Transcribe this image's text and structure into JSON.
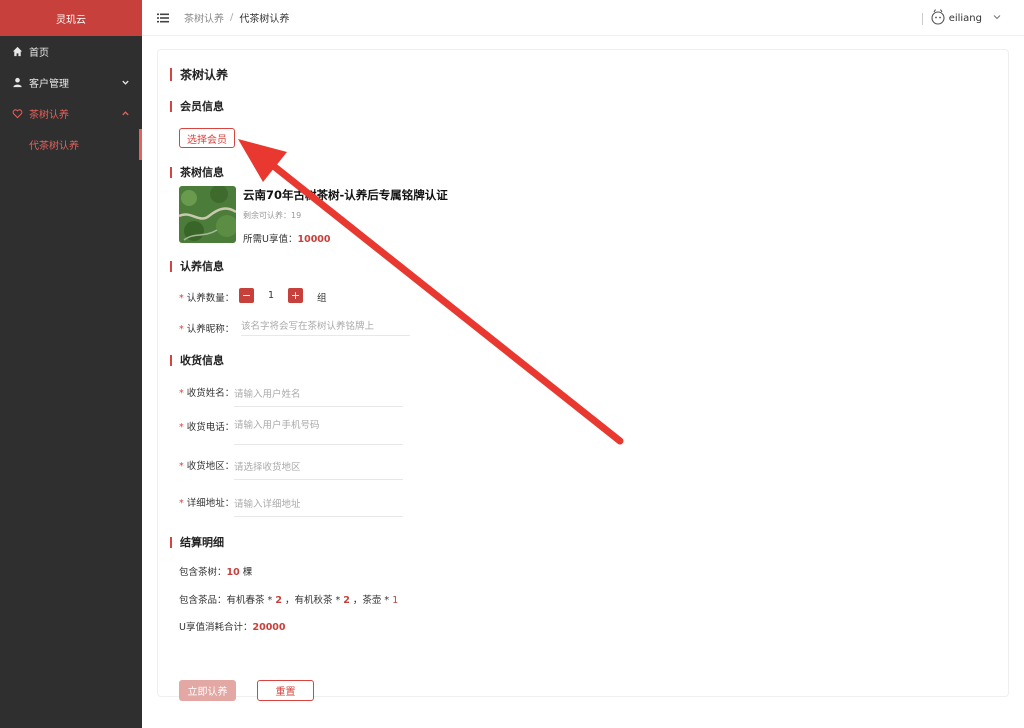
{
  "app": {
    "logo": "灵玑云"
  },
  "sidebar": {
    "items": [
      {
        "label": "首页",
        "icon": "home-icon"
      },
      {
        "label": "客户管理",
        "icon": "user-icon"
      },
      {
        "label": "茶树认养",
        "icon": "heart-icon"
      }
    ],
    "sub_items": [
      {
        "label": "代茶树认养"
      }
    ]
  },
  "header": {
    "breadcrumb": [
      "茶树认养",
      "代茶树认养"
    ],
    "separator": "/",
    "username": "eiliang"
  },
  "page": {
    "title": "茶树认养",
    "member_section": "会员信息",
    "select_member_button": "选择会员",
    "tree_section": "茶树信息",
    "product": {
      "title": "云南70年古树茶树-认养后专属铭牌认证",
      "remain_label": "剩余可认养：",
      "remain_value": "19",
      "need_label": "所需U享值：",
      "need_value": "10000"
    },
    "adopt_section": "认养信息",
    "adopt": {
      "qty_label": "认养数量：",
      "qty_minus": "−",
      "qty_value": "1",
      "qty_plus": "+",
      "qty_unit": "组",
      "nickname_label": "认养昵称：",
      "nickname_placeholder": "该名字将会写在茶树认养铭牌上"
    },
    "shipping_section": "收货信息",
    "shipping": {
      "name_label": "收货姓名：",
      "name_placeholder": "请输入用户姓名",
      "phone_label": "收货电话：",
      "phone_placeholder": "请输入用户手机号码",
      "region_label": "收货地区：",
      "region_placeholder": "请选择收货地区",
      "address_label": "详细地址：",
      "address_placeholder": "请输入详细地址"
    },
    "summary_section": "结算明细",
    "summary": {
      "trees_label": "包含茶树：",
      "trees_value": "10",
      "trees_unit": " 棵",
      "goods_label": "包含茶品：",
      "goods_1": "有机春茶 * ",
      "goods_1_qty": "2",
      "goods_2": " ，有机秋茶 * ",
      "goods_2_qty": "2",
      "goods_3": " ，茶壶 * ",
      "goods_3_qty": "1",
      "total_label": "U享值消耗合计：",
      "total_value": "20000"
    },
    "submit_button": "立即认养",
    "reset_button": "重置"
  },
  "colors": {
    "accent": "#c7403b",
    "sidebar_bg": "#2f2f2f",
    "annotation": "#e8382f"
  }
}
